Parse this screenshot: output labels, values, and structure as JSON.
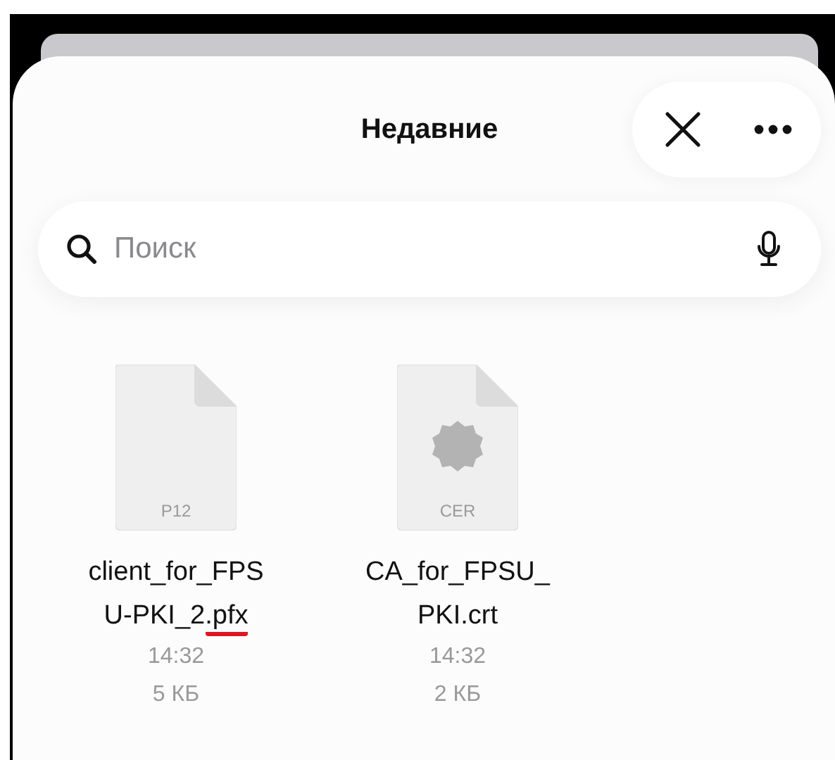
{
  "header": {
    "title": "Недавние"
  },
  "search": {
    "placeholder": "Поиск"
  },
  "files": [
    {
      "kind": "document",
      "badge": "P12",
      "name_lines": [
        "client_for_FPS",
        "U-PKI_2"
      ],
      "extension": ".pfx",
      "extension_underlined": true,
      "time": "14:32",
      "size": "5 КБ"
    },
    {
      "kind": "certificate",
      "badge": "CER",
      "name_lines": [
        "CA_for_FPSU_",
        "PKI"
      ],
      "extension": ".crt",
      "extension_underlined": false,
      "time": "14:32",
      "size": "2 КБ"
    }
  ]
}
